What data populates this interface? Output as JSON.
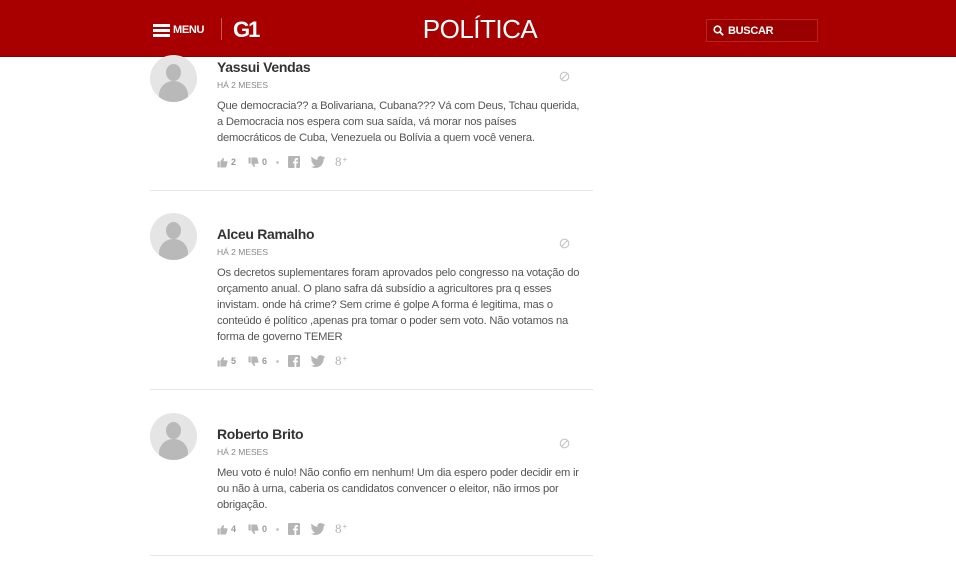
{
  "header": {
    "menu_label": "MENU",
    "logo_text": "G1",
    "section_title": "POLÍTICA",
    "search_label": "BUSCAR",
    "bg_color": "#a80000"
  },
  "comments": [
    {
      "author": "Yassui Vendas",
      "date": "HÁ 2 MESES",
      "text": "Que democracia?? a Bolivariana, Cubana??? Vá com Deus, Tchau querida, a Democracia nos espera com sua saída, vá morar nos países democráticos de Cuba, Venezuela ou Bolívia a quem você venera.",
      "likes": "2",
      "dislikes": "0"
    },
    {
      "author": "Alceu Ramalho",
      "date": "HÁ 2 MESES",
      "text": "Os decretos suplementares foram aprovados pelo congresso na votação do orçamento anual. O plano safra dá subsídio a agricultores pra q esses invistam. onde há crime? Sem crime é golpe A forma é legitima, mas o conteúdo é político ,apenas pra tomar o poder sem voto. Não votamos na forma de governo TEMER",
      "likes": "5",
      "dislikes": "6"
    },
    {
      "author": "Roberto Brito",
      "date": "HÁ 2 MESES",
      "text": "Meu voto é nulo! Não confio em nenhum! Um dia espero poder decidir em ir ou não à urna, caberia os candidatos convencer o eleitor, não irmos por obrigação.",
      "likes": "4",
      "dislikes": "0"
    }
  ],
  "icons": {
    "menu": "hamburger-icon",
    "search": "search-icon",
    "flag": "report-icon",
    "like": "thumbs-up-icon",
    "dislike": "thumbs-down-icon",
    "facebook": "facebook-icon",
    "twitter": "twitter-icon",
    "google_plus": "google-plus-icon"
  }
}
